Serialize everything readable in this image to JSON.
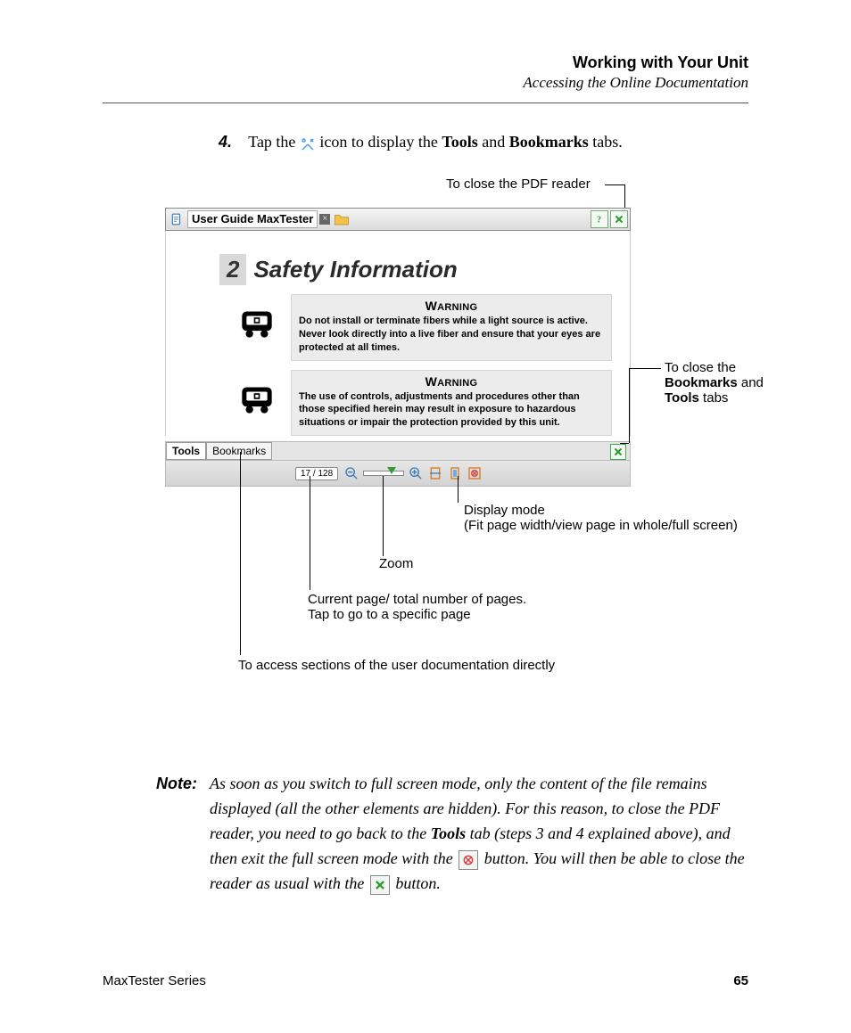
{
  "header": {
    "title": "Working with Your Unit",
    "subtitle": "Accessing the Online Documentation"
  },
  "step": {
    "num": "4.",
    "pre": "Tap the ",
    "mid": " icon to display the ",
    "w1": "Tools",
    "and": " and ",
    "w2": "Bookmarks",
    "post": " tabs."
  },
  "callouts": {
    "closeReader": "To close the PDF reader",
    "closeTabs_pre": "To close the ",
    "closeTabs_b1": "Bookmarks",
    "closeTabs_and": " and ",
    "closeTabs_b2": "Tools",
    "closeTabs_post": " tabs",
    "displayMode": "Display mode",
    "displayModeSub": "(Fit page width/view page in whole/full screen)",
    "zoom": "Zoom",
    "pageCount": "Current page/ total number of pages.\nTap to go to a specific page",
    "bookmarksAccess": "To access sections of the user documentation directly"
  },
  "pdf": {
    "docTitle": "User Guide MaxTester",
    "chapterNum": "2",
    "chapterTitle": "Safety Information",
    "warnHead": "WARNING",
    "warn1": "Do not install or terminate fibers while a light source is active. Never look directly into a live fiber and ensure that your eyes are protected at all times.",
    "warn2": "The use of controls, adjustments and procedures other than those specified herein may result in exposure to hazardous situations or impair the protection provided by this unit.",
    "tab1": "Tools",
    "tab2": "Bookmarks",
    "pageCounter": "17 / 128"
  },
  "note": {
    "label": "Note:",
    "t1": "As soon as you switch to full screen mode, only the content of the file remains displayed (all the other elements are hidden). For this reason, to close the PDF reader, you need to go back to the ",
    "b1": "Tools",
    "t2": " tab (steps 3 and 4 explained above), and then exit the full screen mode with the ",
    "t3": " button. You will then be able to close the reader as usual with the ",
    "t4": " button."
  },
  "footer": {
    "series": "MaxTester Series",
    "page": "65"
  }
}
